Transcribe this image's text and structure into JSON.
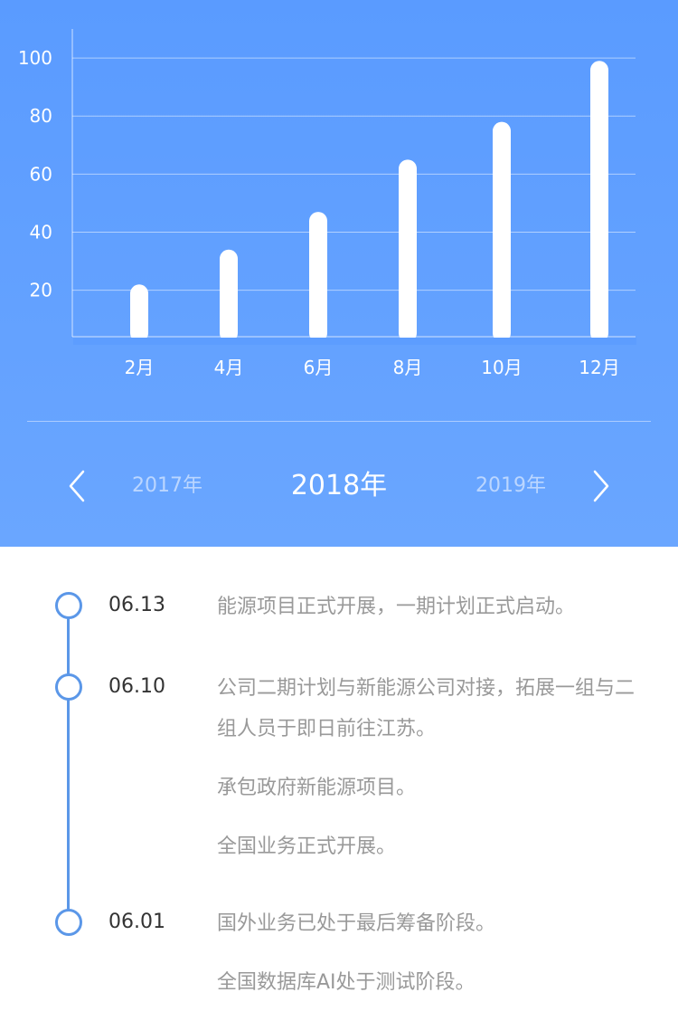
{
  "chart_data": {
    "type": "bar",
    "categories": [
      "2月",
      "4月",
      "6月",
      "8月",
      "10月",
      "12月"
    ],
    "values": [
      22,
      34,
      47,
      65,
      78,
      99
    ],
    "yticks": [
      20,
      40,
      60,
      80,
      100
    ],
    "ylim": [
      4,
      110
    ],
    "grid": true,
    "colors": {
      "bar": "#ffffff",
      "grid": "rgba(255,255,255,0.5)",
      "axis": "rgba(255,255,255,0.7)"
    }
  },
  "year_nav": {
    "prev": "2017年",
    "current": "2018年",
    "next": "2019年"
  },
  "timeline": {
    "entries": [
      {
        "date": "06.13",
        "items": [
          "能源项目正式开展，一期计划正式启动。"
        ]
      },
      {
        "date": "06.10",
        "items": [
          "公司二期计划与新能源公司对接，拓展一组与二组人员于即日前往江苏。",
          "承包政府新能源项目。",
          "全国业务正式开展。"
        ]
      },
      {
        "date": "06.01",
        "items": [
          "国外业务已处于最后筹备阶段。",
          "全国数据库AI处于测试阶段。"
        ]
      }
    ]
  }
}
